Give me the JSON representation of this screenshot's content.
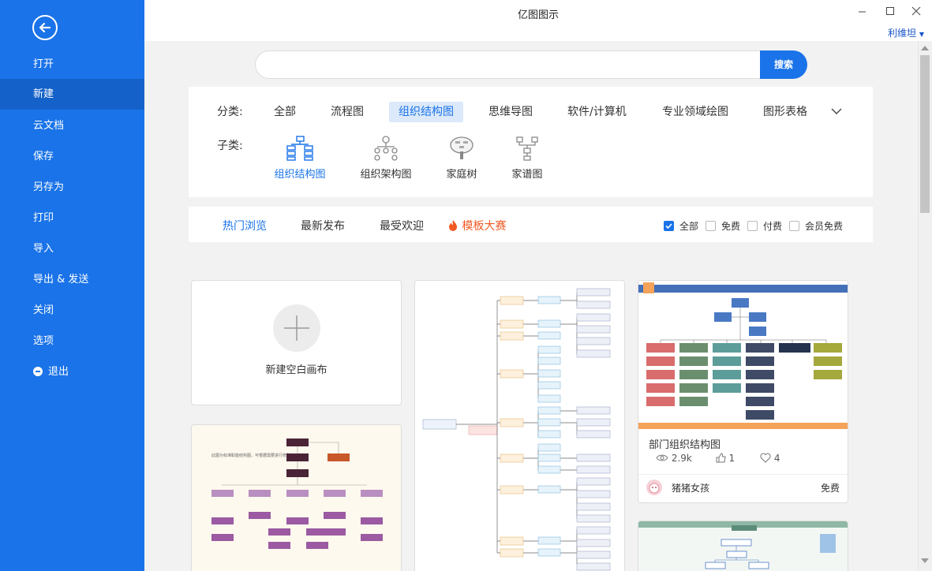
{
  "window": {
    "title": "亿图图示",
    "user": "利维坦"
  },
  "sidebar": {
    "items": [
      {
        "label": "打开"
      },
      {
        "label": "新建"
      },
      {
        "label": "云文档"
      },
      {
        "label": "保存"
      },
      {
        "label": "另存为"
      },
      {
        "label": "打印"
      },
      {
        "label": "导入"
      },
      {
        "label": "导出 & 发送"
      },
      {
        "label": "关闭"
      },
      {
        "label": "选项"
      },
      {
        "label": "退出"
      }
    ]
  },
  "search": {
    "placeholder": "",
    "button": "搜索"
  },
  "categories": {
    "label": "分类:",
    "items": [
      "全部",
      "流程图",
      "组织结构图",
      "思维导图",
      "软件/计算机",
      "专业领域绘图",
      "图形表格"
    ],
    "active": "组织结构图"
  },
  "subcategories": {
    "label": "子类:",
    "items": [
      "组织结构图",
      "组织架构图",
      "家庭树",
      "家谱图"
    ],
    "active": "组织结构图"
  },
  "sort_tabs": {
    "items": [
      "热门浏览",
      "最新发布",
      "最受欢迎",
      "模板大赛"
    ],
    "active": "热门浏览"
  },
  "filters": [
    {
      "label": "全部",
      "checked": true
    },
    {
      "label": "免费",
      "checked": false
    },
    {
      "label": "付费",
      "checked": false
    },
    {
      "label": "会员免费",
      "checked": false
    }
  ],
  "new_blank": {
    "label": "新建空白画布"
  },
  "template_card": {
    "title": "部门组织结构图",
    "views": "2.9k",
    "likes": "1",
    "favorites": "4",
    "author": "猪猪女孩",
    "price": "免费"
  },
  "colors": {
    "accent": "#1a73e8",
    "sidebar": "#1a73e8",
    "contest": "#f05a24"
  }
}
